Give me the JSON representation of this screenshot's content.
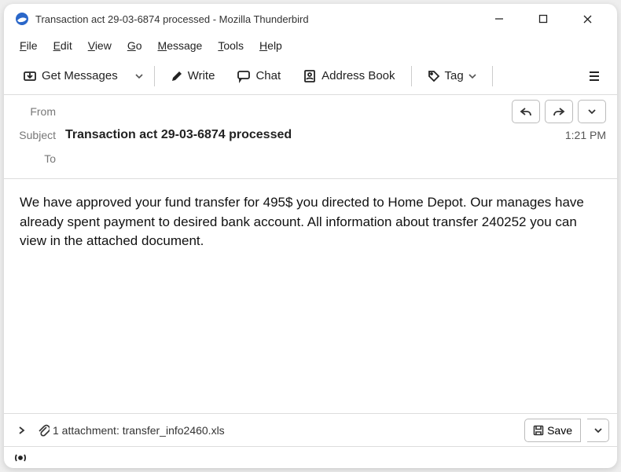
{
  "window": {
    "title": "Transaction act 29-03-6874 processed - Mozilla Thunderbird"
  },
  "menu": {
    "file": "File",
    "edit": "Edit",
    "view": "View",
    "go": "Go",
    "message": "Message",
    "tools": "Tools",
    "help": "Help"
  },
  "toolbar": {
    "get_messages": "Get Messages",
    "write": "Write",
    "chat": "Chat",
    "address_book": "Address Book",
    "tag": "Tag"
  },
  "headers": {
    "from_label": "From",
    "subject_label": "Subject",
    "to_label": "To",
    "from_value": "",
    "subject_value": "Transaction act 29-03-6874 processed",
    "to_value": "",
    "time": "1:21 PM"
  },
  "body": " We have approved your fund transfer for 495$ you directed to Home Depot. Our manages have already spent payment to desired bank account. All information about transfer 240252 you can view in the attached document.",
  "attachment": {
    "summary": "1 attachment: transfer_info2460.xls",
    "save_label": "Save"
  }
}
